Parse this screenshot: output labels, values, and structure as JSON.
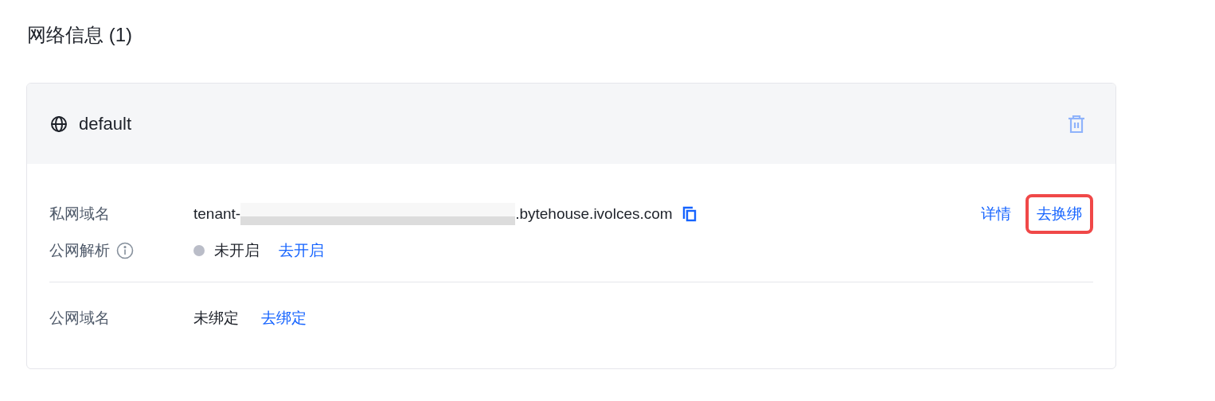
{
  "section_title": "网络信息 (1)",
  "network": {
    "name": "default",
    "delete_disabled": true
  },
  "private_domain": {
    "label": "私网域名",
    "prefix": "tenant-",
    "suffix": ".bytehouse.ivolces.com",
    "actions": [
      {
        "label": "详情",
        "highlighted": false
      },
      {
        "label": "去换绑",
        "highlighted": true
      }
    ]
  },
  "public_resolution": {
    "label": "公网解析",
    "status": "未开启",
    "enabled": false,
    "action": "去开启"
  },
  "public_domain": {
    "label": "公网域名",
    "value": "未绑定",
    "action": "去绑定"
  }
}
